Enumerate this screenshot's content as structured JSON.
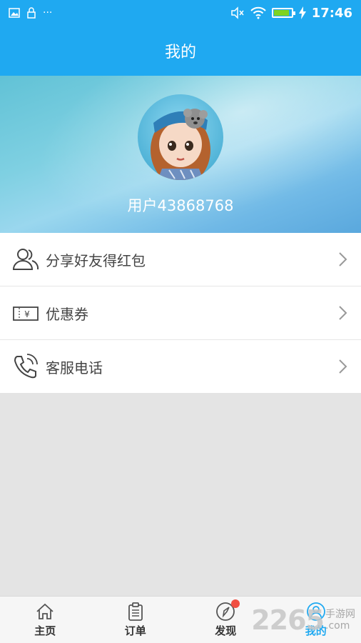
{
  "status_bar": {
    "time": "17:46",
    "left_icons": [
      "image-icon",
      "lock-icon",
      "more-dots-icon"
    ],
    "more_label": "···",
    "right_icons": [
      "mute-icon",
      "wifi-icon",
      "battery-icon",
      "charging-icon"
    ],
    "battery_level": 0.9
  },
  "header": {
    "title": "我的"
  },
  "profile": {
    "username": "用户43868768",
    "avatar_icon": "doll-avatar"
  },
  "menu": {
    "items": [
      {
        "label": "分享好友得红包",
        "icon": "users-icon"
      },
      {
        "label": "优惠券",
        "icon": "coupon-icon",
        "coupon_symbol": "¥"
      },
      {
        "label": "客服电话",
        "icon": "phone-icon"
      }
    ]
  },
  "bottom_nav": {
    "items": [
      {
        "label": "主页",
        "icon": "home-icon"
      },
      {
        "label": "订单",
        "icon": "clipboard-icon"
      },
      {
        "label": "发现",
        "icon": "compass-icon"
      },
      {
        "label": "我的",
        "icon": "user-icon",
        "active": true
      }
    ]
  },
  "watermark": {
    "number": "2265",
    "text_line1": "手游网",
    "text_line2": ".com"
  },
  "colors": {
    "primary": "#1fa9f1",
    "badge": "#f04f43",
    "text": "#444444",
    "background": "#e4e4e4"
  }
}
